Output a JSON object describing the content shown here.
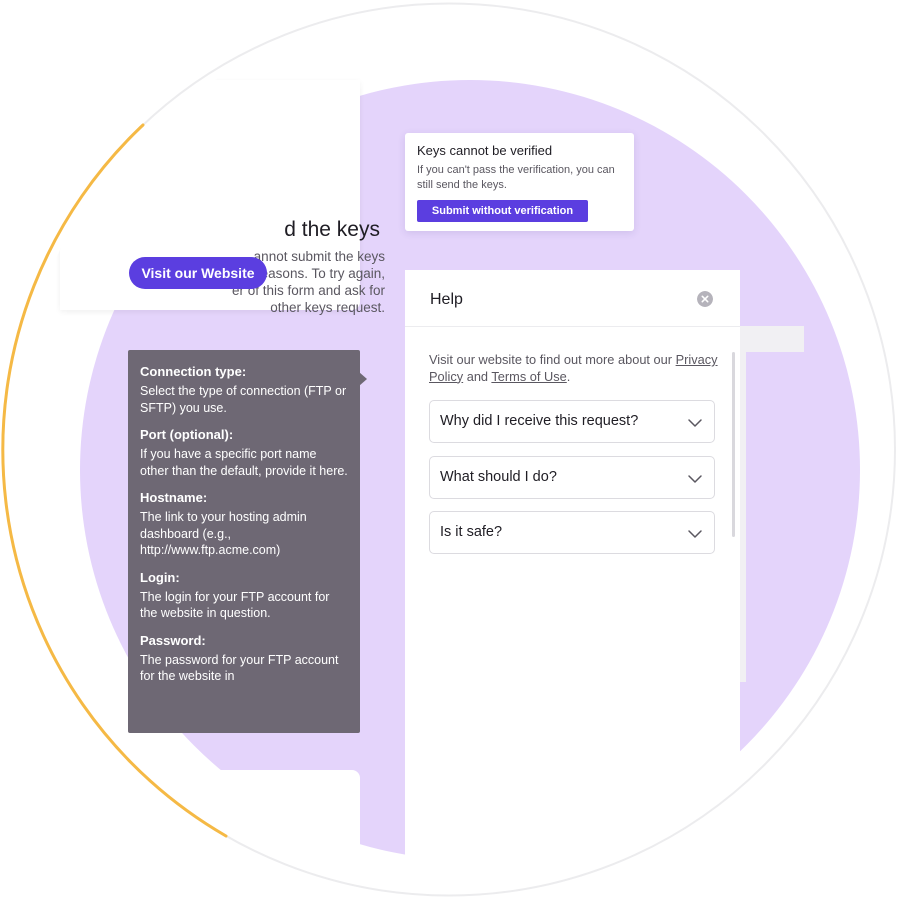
{
  "keys_card": {
    "title_partial": "d the keys",
    "description_partial": "annot submit the keys\nty reasons. To try again,\ner of this form and ask for\nother keys request.",
    "visit_button": "Visit our Website"
  },
  "verify_card": {
    "title": "Keys cannot be verified",
    "text": "If you can't pass the verification, you can still send the keys.",
    "submit_button": "Submit without verification"
  },
  "tooltip": {
    "sections": [
      {
        "heading": "Connection type:",
        "text": "Select the type of connection (FTP or SFTP) you use."
      },
      {
        "heading": "Port (optional):",
        "text": "If you have a specific port name other than the default, provide it here."
      },
      {
        "heading": "Hostname:",
        "text": "The link to your hosting admin dashboard (e.g., http://www.ftp.acme.com)"
      },
      {
        "heading": "Login:",
        "text": "The login for your FTP account for the website in question."
      },
      {
        "heading": "Password:",
        "text": "The password for your FTP account for the website in"
      }
    ]
  },
  "help": {
    "title": "Help",
    "intro_prefix": "Visit our website to find out more about our",
    "privacy_link": "Privacy Policy",
    "intro_and": "and",
    "terms_link": "Terms of Use",
    "intro_suffix": ".",
    "faqs": [
      {
        "question": "Why did I receive this request?"
      },
      {
        "question": "What should I do?"
      },
      {
        "question": "Is it safe?"
      }
    ]
  },
  "colors": {
    "accent": "#5b3ee0",
    "lavender": "#e4d4fb",
    "tooltip_bg": "#6e6874",
    "arc": "#f5b945"
  }
}
